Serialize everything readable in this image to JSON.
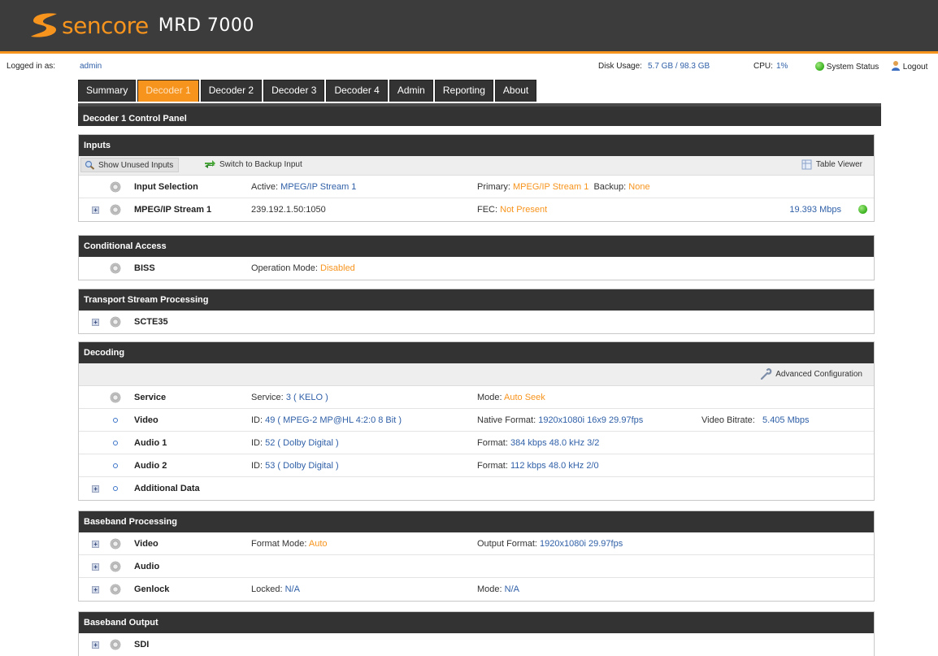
{
  "header": {
    "brand": "sencore",
    "product": "MRD 7000"
  },
  "status": {
    "logged_label": "Logged in as:",
    "user": "admin",
    "disk_label": "Disk Usage:",
    "disk_value": "5.7 GB / 98.3 GB",
    "cpu_label": "CPU:",
    "cpu_value": "1%",
    "system_status": "System Status",
    "logout": "Logout"
  },
  "tabs": [
    "Summary",
    "Decoder 1",
    "Decoder 2",
    "Decoder 3",
    "Decoder 4",
    "Admin",
    "Reporting",
    "About"
  ],
  "active_tab": "Decoder 1",
  "panel_title": "Decoder 1 Control Panel",
  "inputs": {
    "title": "Inputs",
    "show_unused": "Show Unused Inputs",
    "switch_backup": "Switch to Backup Input",
    "table_viewer": "Table Viewer",
    "selection": {
      "label": "Input Selection",
      "active_label": "Active:",
      "active_value": "MPEG/IP Stream 1",
      "primary_label": "Primary:",
      "primary_value": "MPEG/IP Stream 1",
      "backup_label": "Backup:",
      "backup_value": "None"
    },
    "stream": {
      "label": "MPEG/IP Stream 1",
      "address": "239.192.1.50:1050",
      "fec_label": "FEC:",
      "fec_value": "Not Present",
      "rate": "19.393  Mbps"
    }
  },
  "ca": {
    "title": "Conditional Access",
    "label": "BISS",
    "mode_label": "Operation Mode:",
    "mode_value": "Disabled"
  },
  "tsp": {
    "title": "Transport Stream Processing",
    "label": "SCTE35"
  },
  "decoding": {
    "title": "Decoding",
    "advanced": "Advanced Configuration",
    "service": {
      "label": "Service",
      "svc_label": "Service:",
      "svc_value": "3 ( KELO )",
      "mode_label": "Mode:",
      "mode_value": "Auto Seek"
    },
    "video": {
      "label": "Video",
      "id_label": "ID:",
      "id_value": "49 ( MPEG-2  MP@HL  4:2:0 8 Bit )",
      "fmt_label": "Native Format:",
      "fmt_value": "1920x1080i 16x9 29.97fps",
      "br_label": "Video Bitrate:",
      "br_value": "5.405  Mbps"
    },
    "audio1": {
      "label": "Audio 1",
      "id_label": "ID:",
      "id_value": "52 ( Dolby Digital )",
      "fmt_label": "Format:",
      "fmt_value": "384 kbps 48.0 kHz  3/2"
    },
    "audio2": {
      "label": "Audio 2",
      "id_label": "ID:",
      "id_value": "53 ( Dolby Digital )",
      "fmt_label": "Format:",
      "fmt_value": "112 kbps 48.0 kHz  2/0"
    },
    "additional": {
      "label": "Additional Data"
    }
  },
  "baseband": {
    "title": "Baseband Processing",
    "video": {
      "label": "Video",
      "fm_label": "Format Mode:",
      "fm_value": "Auto",
      "of_label": "Output Format:",
      "of_value": "1920x1080i 29.97fps"
    },
    "audio": {
      "label": "Audio"
    },
    "genlock": {
      "label": "Genlock",
      "locked_label": "Locked:",
      "locked_value": "N/A",
      "mode_label": "Mode:",
      "mode_value": "N/A"
    }
  },
  "output": {
    "title": "Baseband Output",
    "label": "SDI"
  },
  "colors": {
    "accent": "#f7941d",
    "header_bg": "#3c3c3c",
    "section_bg": "#333333",
    "link": "#3060a8",
    "status_ok": "#37b01c"
  }
}
